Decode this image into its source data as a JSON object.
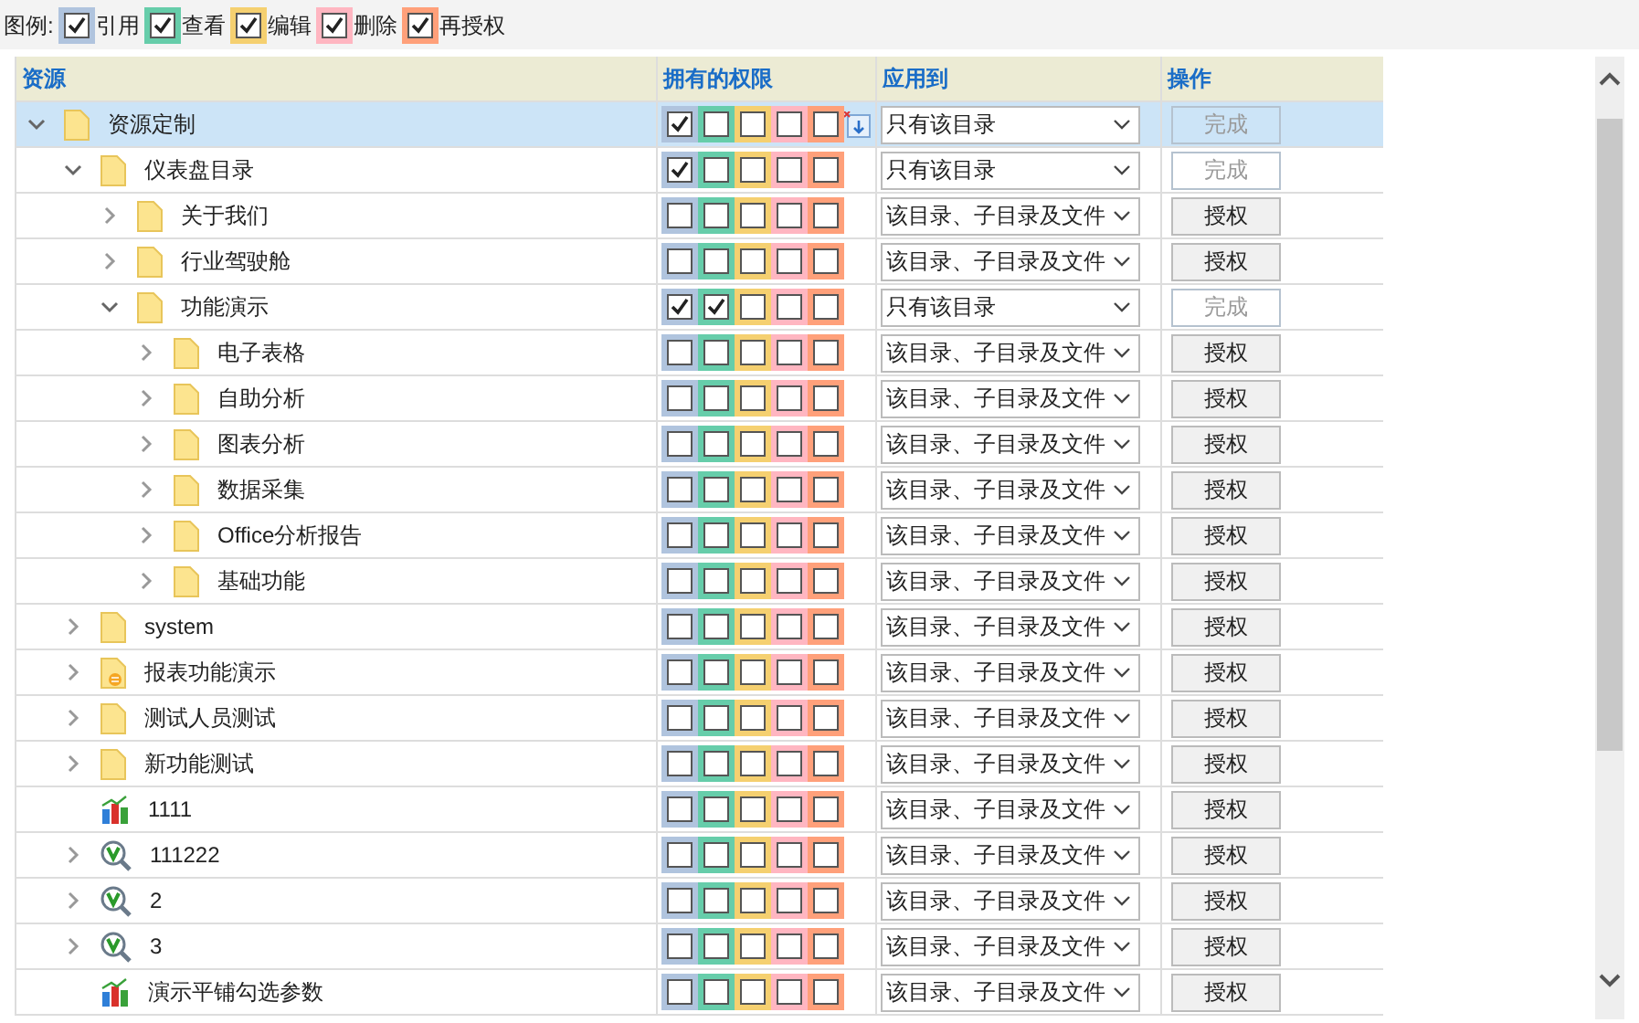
{
  "legend": {
    "label": "图例:",
    "items": [
      {
        "label": "引用",
        "color": "#b0c4de",
        "checked": true
      },
      {
        "label": "查看",
        "color": "#66cdaa",
        "checked": true
      },
      {
        "label": "编辑",
        "color": "#f5d070",
        "checked": true
      },
      {
        "label": "删除",
        "color": "#ffb6c1",
        "checked": true
      },
      {
        "label": "再授权",
        "color": "#ffa07a",
        "checked": true
      }
    ]
  },
  "table": {
    "columns": [
      "资源",
      "拥有的权限",
      "应用到",
      "操作"
    ],
    "rows": [
      {
        "name": "资源定制",
        "kind": "folder",
        "expanded": true,
        "selected": true,
        "extra_icon": true,
        "perms": [
          true,
          false,
          false,
          false,
          false
        ],
        "apply": "只有该目录",
        "action": "完成",
        "disabled": true,
        "children": [
          {
            "name": "仪表盘目录",
            "kind": "folder",
            "expanded": true,
            "selected": false,
            "extra_icon": false,
            "perms": [
              true,
              false,
              false,
              false,
              false
            ],
            "apply": "只有该目录",
            "action": "完成",
            "disabled": true,
            "children": [
              {
                "name": "关于我们",
                "kind": "folder",
                "expanded": false,
                "selected": false,
                "extra_icon": false,
                "perms": [
                  false,
                  false,
                  false,
                  false,
                  false
                ],
                "apply": "该目录、子目录及文件",
                "action": "授权",
                "disabled": false
              },
              {
                "name": "行业驾驶舱",
                "kind": "folder",
                "expanded": false,
                "selected": false,
                "extra_icon": false,
                "perms": [
                  false,
                  false,
                  false,
                  false,
                  false
                ],
                "apply": "该目录、子目录及文件",
                "action": "授权",
                "disabled": false
              },
              {
                "name": "功能演示",
                "kind": "folder",
                "expanded": true,
                "selected": false,
                "extra_icon": false,
                "perms": [
                  true,
                  true,
                  false,
                  false,
                  false
                ],
                "apply": "只有该目录",
                "action": "完成",
                "disabled": true,
                "children": [
                  {
                    "name": "电子表格",
                    "kind": "folder",
                    "expanded": false,
                    "selected": false,
                    "extra_icon": false,
                    "perms": [
                      false,
                      false,
                      false,
                      false,
                      false
                    ],
                    "apply": "该目录、子目录及文件",
                    "action": "授权",
                    "disabled": false
                  },
                  {
                    "name": "自助分析",
                    "kind": "folder",
                    "expanded": false,
                    "selected": false,
                    "extra_icon": false,
                    "perms": [
                      false,
                      false,
                      false,
                      false,
                      false
                    ],
                    "apply": "该目录、子目录及文件",
                    "action": "授权",
                    "disabled": false
                  },
                  {
                    "name": "图表分析",
                    "kind": "folder",
                    "expanded": false,
                    "selected": false,
                    "extra_icon": false,
                    "perms": [
                      false,
                      false,
                      false,
                      false,
                      false
                    ],
                    "apply": "该目录、子目录及文件",
                    "action": "授权",
                    "disabled": false
                  },
                  {
                    "name": "数据采集",
                    "kind": "folder",
                    "expanded": false,
                    "selected": false,
                    "extra_icon": false,
                    "perms": [
                      false,
                      false,
                      false,
                      false,
                      false
                    ],
                    "apply": "该目录、子目录及文件",
                    "action": "授权",
                    "disabled": false
                  },
                  {
                    "name": "Office分析报告",
                    "kind": "folder",
                    "expanded": false,
                    "selected": false,
                    "extra_icon": false,
                    "perms": [
                      false,
                      false,
                      false,
                      false,
                      false
                    ],
                    "apply": "该目录、子目录及文件",
                    "action": "授权",
                    "disabled": false
                  },
                  {
                    "name": "基础功能",
                    "kind": "folder",
                    "expanded": false,
                    "selected": false,
                    "extra_icon": false,
                    "perms": [
                      false,
                      false,
                      false,
                      false,
                      false
                    ],
                    "apply": "该目录、子目录及文件",
                    "action": "授权",
                    "disabled": false
                  }
                ]
              }
            ]
          },
          {
            "name": "system",
            "kind": "folder",
            "expanded": false,
            "selected": false,
            "extra_icon": false,
            "perms": [
              false,
              false,
              false,
              false,
              false
            ],
            "apply": "该目录、子目录及文件",
            "action": "授权",
            "disabled": false
          },
          {
            "name": "报表功能演示",
            "kind": "report-folder",
            "expanded": false,
            "selected": false,
            "extra_icon": false,
            "perms": [
              false,
              false,
              false,
              false,
              false
            ],
            "apply": "该目录、子目录及文件",
            "action": "授权",
            "disabled": false
          },
          {
            "name": "测试人员测试",
            "kind": "folder",
            "expanded": false,
            "selected": false,
            "extra_icon": false,
            "perms": [
              false,
              false,
              false,
              false,
              false
            ],
            "apply": "该目录、子目录及文件",
            "action": "授权",
            "disabled": false
          },
          {
            "name": "新功能测试",
            "kind": "folder",
            "expanded": false,
            "selected": false,
            "extra_icon": false,
            "perms": [
              false,
              false,
              false,
              false,
              false
            ],
            "apply": "该目录、子目录及文件",
            "action": "授权",
            "disabled": false
          },
          {
            "name": "1111",
            "kind": "chart",
            "selected": false,
            "extra_icon": false,
            "perms": [
              false,
              false,
              false,
              false,
              false
            ],
            "apply": "该目录、子目录及文件",
            "action": "授权",
            "disabled": false
          },
          {
            "name": "111222",
            "kind": "view",
            "expanded": false,
            "selected": false,
            "extra_icon": false,
            "perms": [
              false,
              false,
              false,
              false,
              false
            ],
            "apply": "该目录、子目录及文件",
            "action": "授权",
            "disabled": false
          },
          {
            "name": "2",
            "kind": "view",
            "expanded": false,
            "selected": false,
            "extra_icon": false,
            "perms": [
              false,
              false,
              false,
              false,
              false
            ],
            "apply": "该目录、子目录及文件",
            "action": "授权",
            "disabled": false
          },
          {
            "name": "3",
            "kind": "view",
            "expanded": false,
            "selected": false,
            "extra_icon": false,
            "perms": [
              false,
              false,
              false,
              false,
              false
            ],
            "apply": "该目录、子目录及文件",
            "action": "授权",
            "disabled": false
          },
          {
            "name": "演示平铺勾选参数",
            "kind": "chart",
            "selected": false,
            "extra_icon": false,
            "perms": [
              false,
              false,
              false,
              false,
              false
            ],
            "apply": "该目录、子目录及文件",
            "action": "授权",
            "disabled": false
          }
        ]
      }
    ]
  }
}
